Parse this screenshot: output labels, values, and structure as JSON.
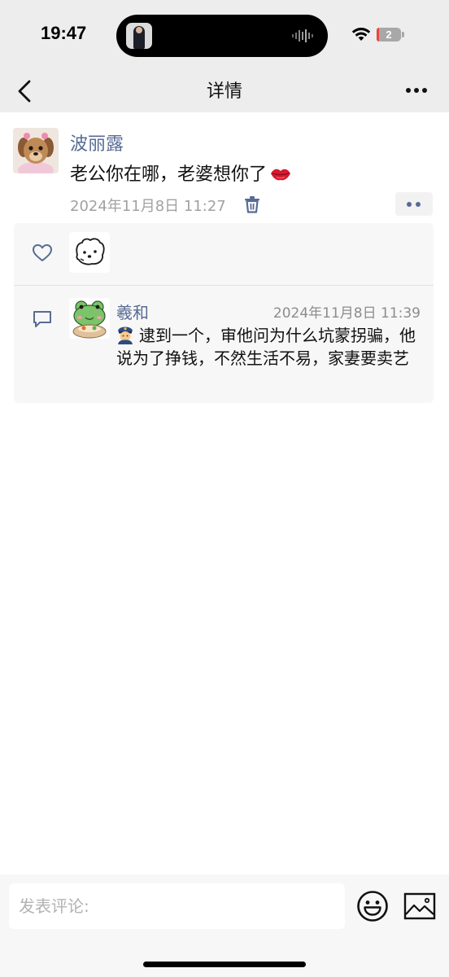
{
  "status_bar": {
    "time": "19:47",
    "battery_level": "2",
    "icons": [
      "wifi-icon",
      "battery-icon",
      "audio-wave-icon"
    ]
  },
  "nav": {
    "title": "详情",
    "back_icon": "chevron-left-icon",
    "more_icon": "more-dots-icon"
  },
  "post": {
    "author": "波丽露",
    "text": "老公你在哪，老婆想你了",
    "text_emoji": "lips-icon",
    "time": "2024年11月8日 11:27",
    "delete_icon": "trash-icon",
    "actions_icon": "two-dots-icon"
  },
  "interactions": {
    "like_icon": "heart-outline-icon",
    "comment_icon": "comment-bubble-icon",
    "comments": [
      {
        "author": "羲和",
        "time": "2024年11月8日 11:39",
        "emoji": "police-officer-icon",
        "text": "逮到一个，审他问为什么坑蒙拐骗，他说为了挣钱，不然生活不易，家妻要卖艺"
      }
    ]
  },
  "composer": {
    "placeholder": "发表评论:",
    "emoji_icon": "smiley-icon",
    "image_icon": "image-icon"
  },
  "colors": {
    "link_blue": "#576b95",
    "bar_bg": "#ededed",
    "box_bg": "#f7f7f7",
    "time_gray": "#a1a1a1"
  }
}
